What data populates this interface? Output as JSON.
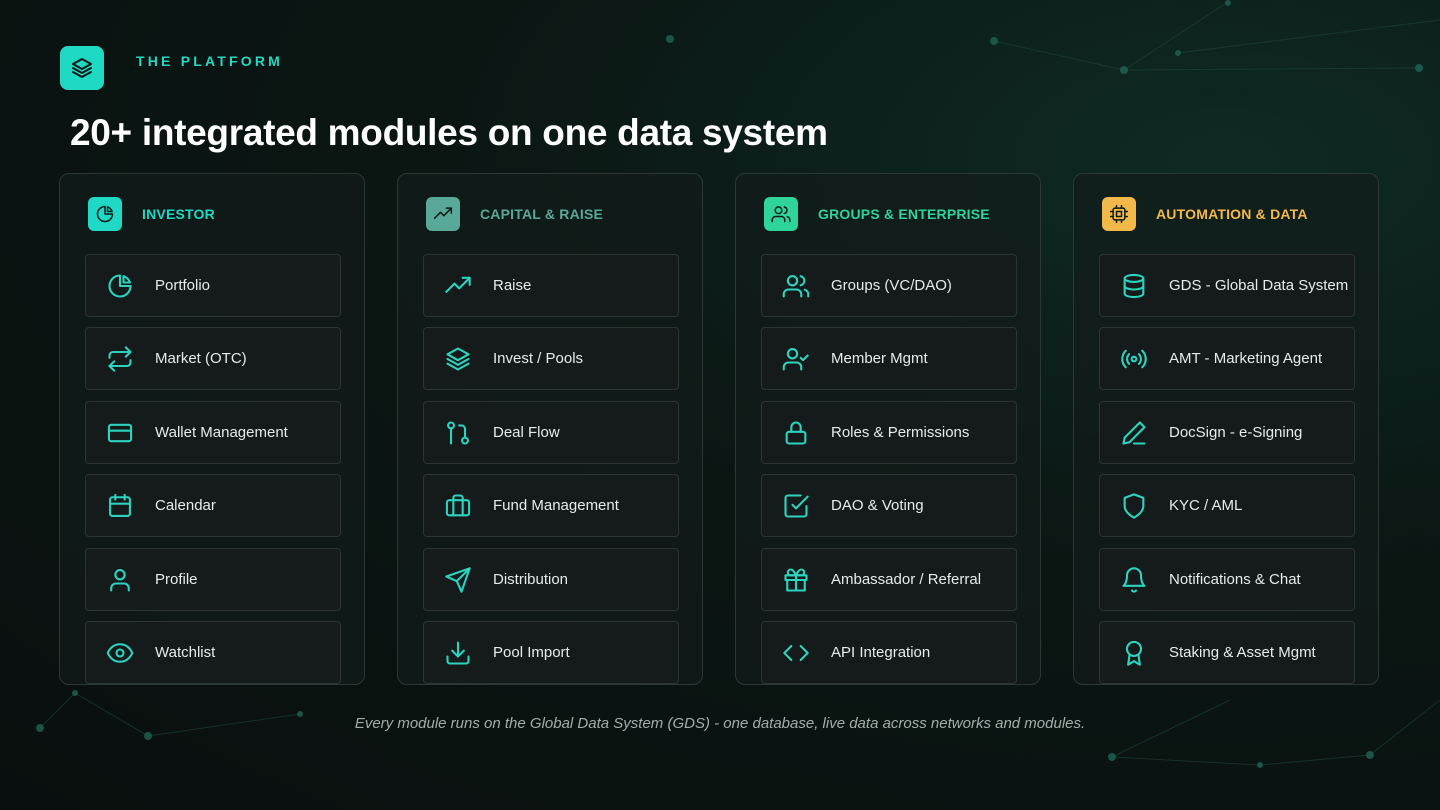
{
  "brand": {
    "logo_icon": "layers-icon",
    "eyebrow": "THE PLATFORM",
    "accent": "#1fd9c4"
  },
  "headline": "20+ integrated modules on one data system",
  "columns": [
    {
      "title": "INVESTOR",
      "icon": "pie-chart-icon",
      "color": "#1fd9c4",
      "items": [
        {
          "label": "Portfolio",
          "icon": "pie-chart-icon"
        },
        {
          "label": "Market (OTC)",
          "icon": "repeat-icon"
        },
        {
          "label": "Wallet Management",
          "icon": "credit-card-icon"
        },
        {
          "label": "Calendar",
          "icon": "calendar-icon"
        },
        {
          "label": "Profile",
          "icon": "user-icon"
        },
        {
          "label": "Watchlist",
          "icon": "eye-icon"
        }
      ]
    },
    {
      "title": "CAPITAL & RAISE",
      "icon": "trending-up-icon",
      "color": "#5aa898",
      "items": [
        {
          "label": "Raise",
          "icon": "trending-up-icon"
        },
        {
          "label": "Invest / Pools",
          "icon": "layers-icon"
        },
        {
          "label": "Deal Flow",
          "icon": "git-pull-request-icon"
        },
        {
          "label": "Fund Management",
          "icon": "briefcase-icon"
        },
        {
          "label": "Distribution",
          "icon": "send-icon"
        },
        {
          "label": "Pool Import",
          "icon": "download-icon"
        }
      ]
    },
    {
      "title": "GROUPS & ENTERPRISE",
      "icon": "users-icon",
      "color": "#2fd49a",
      "items": [
        {
          "label": "Groups (VC/DAO)",
          "icon": "users-icon"
        },
        {
          "label": "Member Mgmt",
          "icon": "user-check-icon"
        },
        {
          "label": "Roles & Permissions",
          "icon": "lock-icon"
        },
        {
          "label": "DAO & Voting",
          "icon": "check-square-icon"
        },
        {
          "label": "Ambassador / Referral",
          "icon": "gift-icon"
        },
        {
          "label": "API Integration",
          "icon": "code-icon"
        }
      ]
    },
    {
      "title": "AUTOMATION & DATA",
      "icon": "cpu-icon",
      "color": "#f2b94a",
      "items": [
        {
          "label": "GDS - Global Data System",
          "icon": "database-icon"
        },
        {
          "label": "AMT - Marketing Agent",
          "icon": "radio-icon"
        },
        {
          "label": "DocSign - e-Signing",
          "icon": "pen-icon"
        },
        {
          "label": "KYC / AML",
          "icon": "shield-icon"
        },
        {
          "label": "Notifications & Chat",
          "icon": "bell-icon"
        },
        {
          "label": "Staking & Asset Mgmt",
          "icon": "award-icon"
        }
      ]
    }
  ],
  "footer": "Every module runs on the Global Data System (GDS) - one database, live data across networks and modules."
}
